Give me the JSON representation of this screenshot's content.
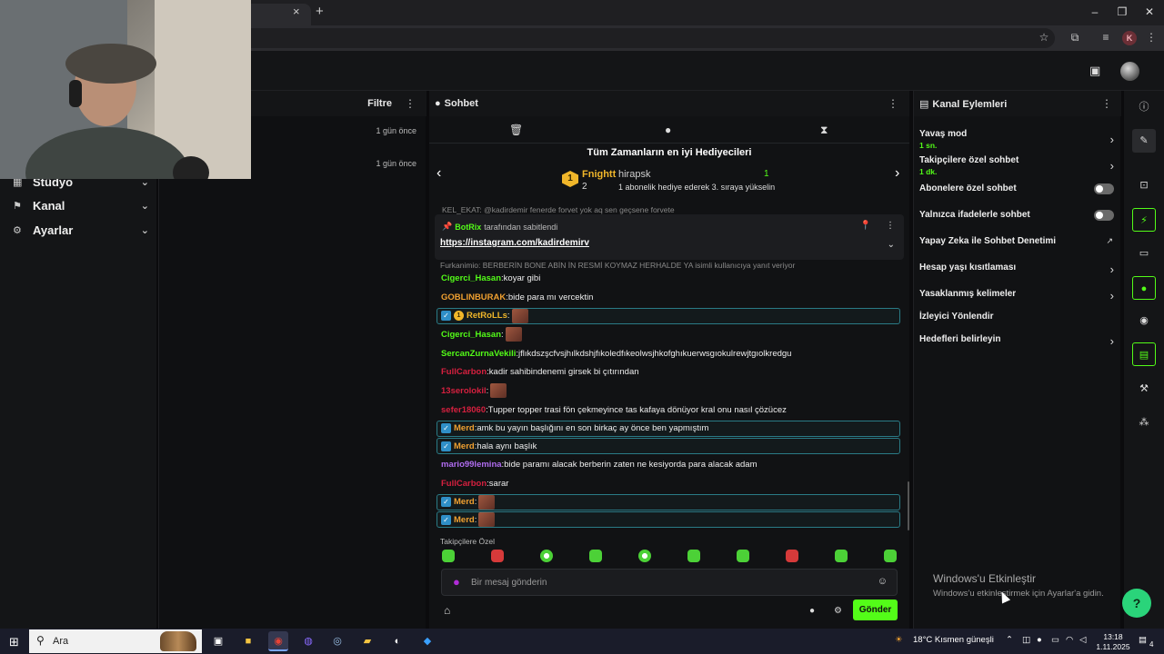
{
  "browser": {
    "tab_close": "×",
    "new_tab": "+",
    "window": {
      "minimize": "–",
      "restore": "❐",
      "close": "✕"
    },
    "profile_initial": "K"
  },
  "sidebar": {
    "items": [
      {
        "label": "Stüdyo",
        "icon": "studio-icon"
      },
      {
        "label": "Kanal",
        "icon": "channel-icon"
      },
      {
        "label": "Ayarlar",
        "icon": "gear-icon"
      }
    ]
  },
  "activity": {
    "filter_label": "Filtre",
    "times": [
      "1 gün önce",
      "1 gün önce"
    ]
  },
  "chat": {
    "title": "Sohbet",
    "leaderboard": {
      "title": "Tüm Zamanların en iyi Hediyecileri",
      "rank": "1",
      "first_name": "Fnightt",
      "first_count": "2",
      "second_name": "hirapsk",
      "second_count": "1",
      "promo": "1 abonelik hediye ederek 3. sıraya yükselin"
    },
    "cut_message": "KEL_EKAT: @kadirdemir fenerde forvet yok aq sen geçsene forvete",
    "pinned": {
      "by_user": "BotRix",
      "by_text": "tarafından sabitlendi",
      "link": "https://instagram.com/kadirdemirv"
    },
    "reply_hint": "Furkanimio: BERBERİN BONE ABİN İN RESMİ KOYMAZ HERHALDE YA isimli kullanıcıya yanıt veriyor",
    "messages": [
      {
        "user": "Cigerci_Hasan",
        "color": "#53fc18",
        "text": "koyar gibi",
        "highlight": false,
        "emote": false
      },
      {
        "user": "GOBLINBURAK",
        "color": "#f0a030",
        "text": "bide para mı vercektin",
        "highlight": false,
        "emote": false
      },
      {
        "user": "RetRoLLs",
        "color": "#f0b62a",
        "text": "",
        "highlight": true,
        "emote": true,
        "sub": true
      },
      {
        "user": "Cigerci_Hasan",
        "color": "#53fc18",
        "text": "",
        "highlight": false,
        "emote": true
      },
      {
        "user": "SercanZurnaVekili",
        "color": "#53fc18",
        "text": "jflıkdszşcfvsjhılkdshjfıkoledfıkeolwsjhkofghıkuerwsgıokulrewjtgıolkredgu",
        "highlight": false,
        "emote": false
      },
      {
        "user": "FullCarbon",
        "color": "#d6203f",
        "text": "kadir sahibindenemi girsek bi çıtırından",
        "highlight": false,
        "emote": false
      },
      {
        "user": "13serolokil",
        "color": "#d6203f",
        "text": "",
        "highlight": false,
        "emote": true
      },
      {
        "user": "sefer18060",
        "color": "#d6203f",
        "text": "Tupper topper trasi fön çekmeyince tas kafaya dönüyor kral onu nasıl çözücez",
        "highlight": false,
        "emote": false
      },
      {
        "user": "Merd",
        "color": "#f0a030",
        "text": "amk bu yayın başlığını en son birkaç ay önce ben yapmıştım",
        "highlight": true,
        "emote": false
      },
      {
        "user": "Merd",
        "color": "#f0a030",
        "text": "hala aynı başlık",
        "highlight": true,
        "emote": false
      },
      {
        "user": "mario99lemina",
        "color": "#b06cf0",
        "text": "bide paramı alacak berberin zaten ne kesiyorda para alacak adam",
        "highlight": false,
        "emote": false
      },
      {
        "user": "FullCarbon",
        "color": "#d6203f",
        "text": "sarar",
        "highlight": false,
        "emote": false
      },
      {
        "user": "Merd",
        "color": "#f0a030",
        "text": "",
        "highlight": true,
        "emote": true
      },
      {
        "user": "Merd",
        "color": "#f0a030",
        "text": "",
        "highlight": true,
        "emote": true
      }
    ],
    "followers_label": "Takipçilere Özel",
    "input_placeholder": "Bir mesaj gönderin",
    "send_label": "Gönder"
  },
  "actions": {
    "title": "Kanal Eylemleri",
    "rows": [
      {
        "label": "Yavaş mod",
        "sub": "1 sn.",
        "control": "chevron"
      },
      {
        "label": "Takipçilere özel sohbet",
        "sub": "1 dk.",
        "control": "chevron"
      },
      {
        "label": "Abonelere özel sohbet",
        "sub": "",
        "control": "toggle"
      },
      {
        "label": "Yalnızca ifadelerle sohbet",
        "sub": "",
        "control": "toggle"
      },
      {
        "label": "Yapay Zeka ile Sohbet Denetimi",
        "sub": "",
        "control": "external"
      },
      {
        "label": "Hesap yaşı kısıtlaması",
        "sub": "",
        "control": "chevron"
      },
      {
        "label": "Yasaklanmış kelimeler",
        "sub": "",
        "control": "chevron"
      },
      {
        "label": "İzleyici Yönlendir",
        "sub": "",
        "control": "none"
      },
      {
        "label": "Hedefleri belirleyin",
        "sub": "",
        "control": "chevron"
      }
    ]
  },
  "windows": {
    "watermark_title": "Windows'u Etkinleştir",
    "watermark_sub": "Windows'u etkinleştirmek için Ayarlar'a gidin.",
    "search_label": "Ara",
    "weather": "18°C  Kısmen güneşli",
    "time": "13:18",
    "date": "1.11.2025",
    "notif_count": "4"
  },
  "colors": {
    "accent": "#53fc18",
    "highlight_border": "#2a7b86",
    "gold": "#f0b62a"
  }
}
